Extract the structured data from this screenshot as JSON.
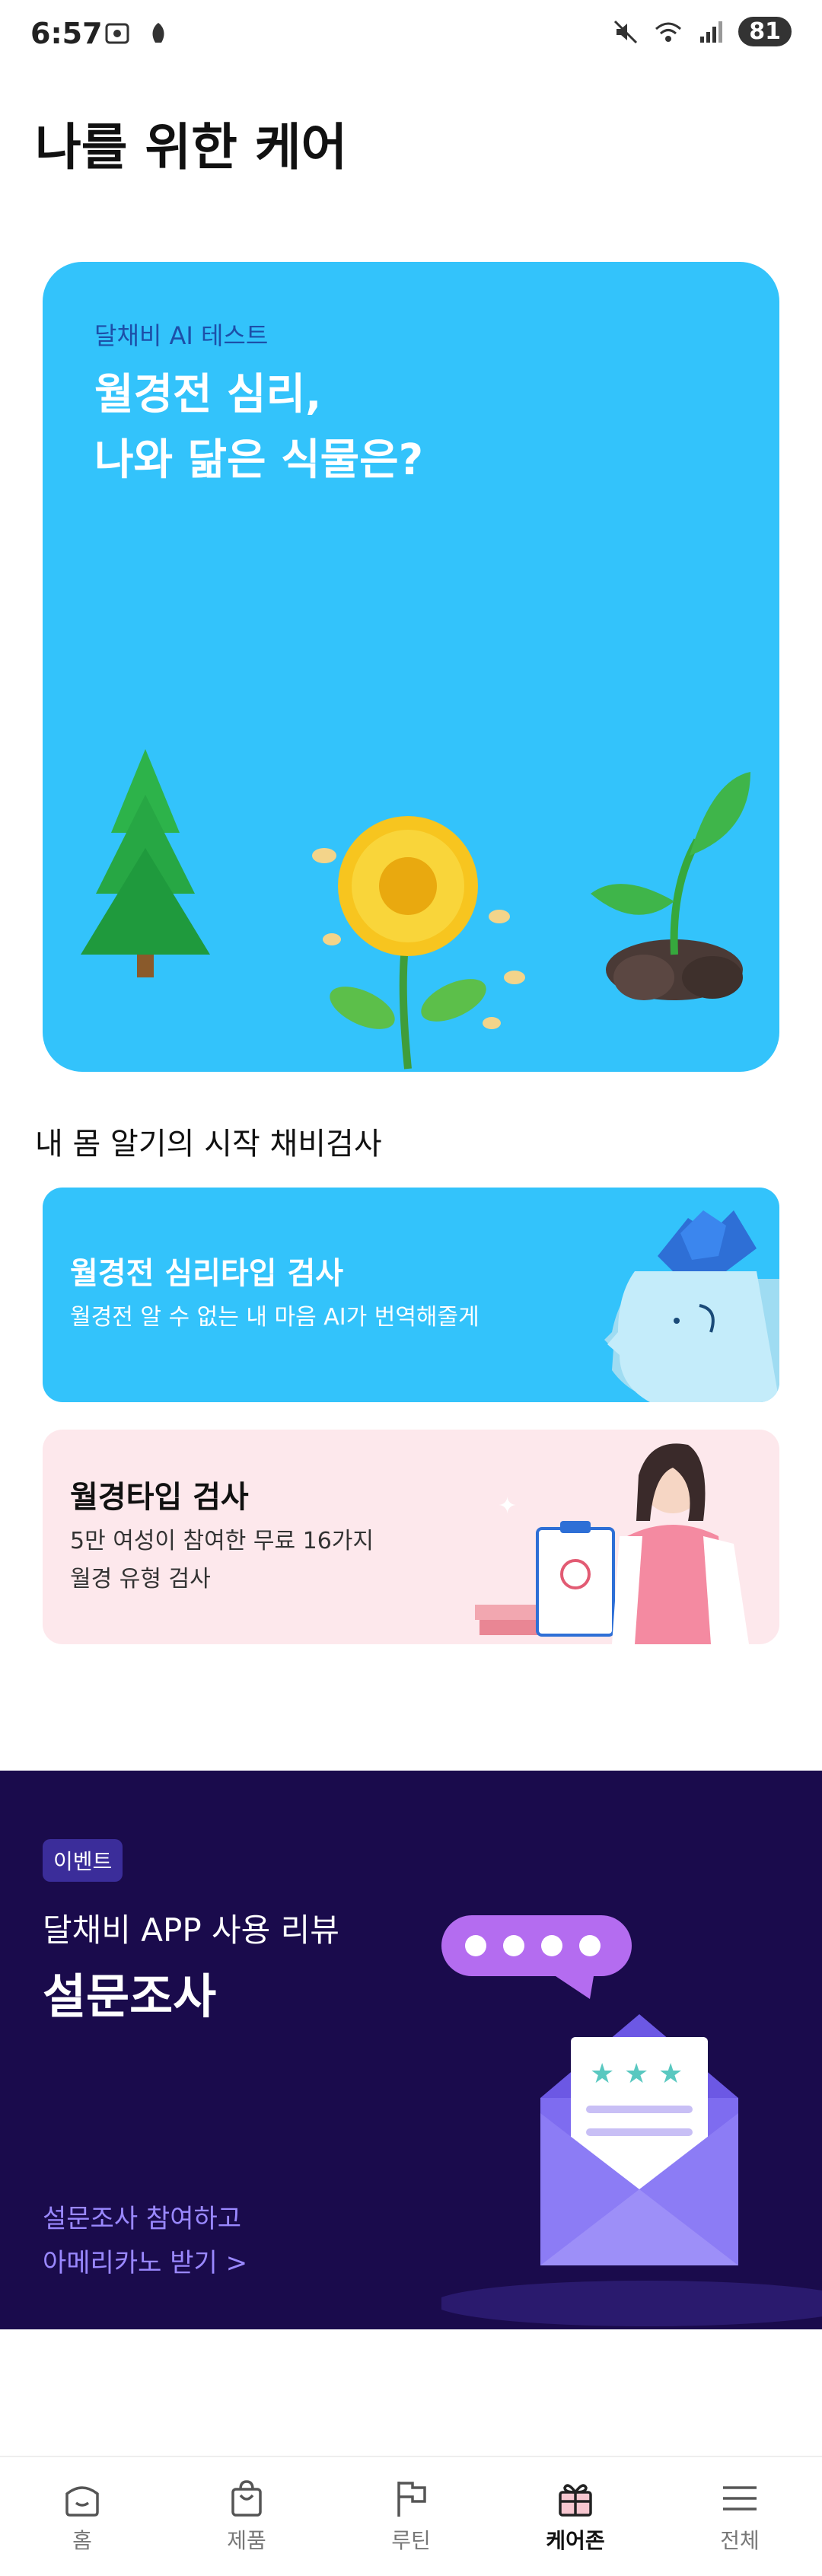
{
  "status_bar": {
    "time": "6:57",
    "battery": "81"
  },
  "page": {
    "title": "나를 위한 케어"
  },
  "hero": {
    "tag": "달채비 AI 테스트",
    "title_line1": "월경전 심리,",
    "title_line2": "나와 닮은 식물은?"
  },
  "section": {
    "title": "내 몸 알기의 시작 채비검사"
  },
  "cards": [
    {
      "title": "월경전 심리타입 검사",
      "desc_line1": "월경전 알 수 없는 내 마음 AI가 번역해줄게",
      "desc_line2": ""
    },
    {
      "title": "월경타입 검사",
      "desc_line1": "5만 여성이 참여한 무료 16가지",
      "desc_line2": "월경 유형 검사"
    }
  ],
  "event": {
    "badge": "이벤트",
    "subtitle": "달채비 APP 사용 리뷰",
    "title": "설문조사",
    "cta_line1": "설문조사 참여하고",
    "cta_line2": "아메리카노 받기 >"
  },
  "nav": [
    {
      "label": "홈",
      "icon": "home-icon"
    },
    {
      "label": "제품",
      "icon": "shopping-bag-icon"
    },
    {
      "label": "루틴",
      "icon": "flag-icon"
    },
    {
      "label": "케어존",
      "icon": "gift-icon"
    },
    {
      "label": "전체",
      "icon": "menu-icon"
    }
  ],
  "colors": {
    "hero_bg": "#33c3fb",
    "event_bg": "#1a0b4c",
    "pink_card_bg": "#fde8ec"
  }
}
